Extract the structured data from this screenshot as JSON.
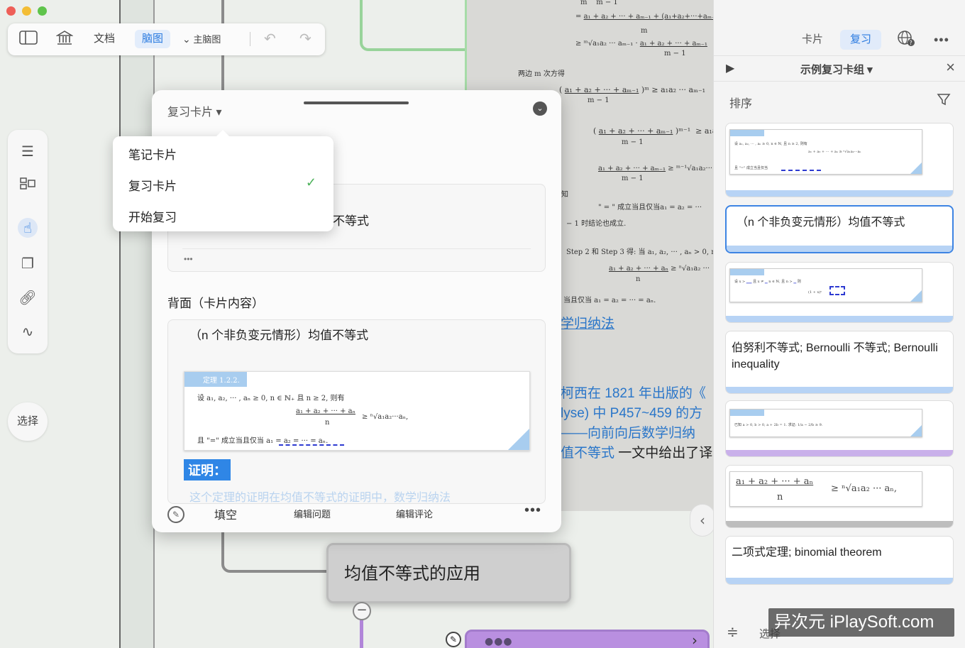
{
  "toolbar": {
    "doc_label": "文档",
    "mindmap_label": "脑图",
    "main_map_label": "主脑图"
  },
  "left_sidebar": {
    "select_label": "选择"
  },
  "document_page": {
    "phrase1": "两边 m 次方得",
    "phrase2": "\" = \" 成立当且仅当a₁ = a₂ = ···",
    "phrase3": "− 1 时结论也成立.",
    "phrase4": "Step 2 和 Step 3 得: 当 a₁, a₂, ··· , aₙ > 0, n",
    "phrase5": "当且仅当 a₁ = a₂ = ··· = aₙ.",
    "phrase6": "知",
    "link1": "学归纳法",
    "text1": "柯西在 1821 年出版的《",
    "text2": "lyse) 中 P457~459 的方",
    "text3": "——向前向后数学归纳",
    "text4_link": "值不等式",
    "text4_rest": " 一文中给出了译"
  },
  "mindmap_node": {
    "label": "均值不等式的应用"
  },
  "popup": {
    "card_type": "复习卡片 ▾",
    "front_text": "不等式",
    "front_more": "•••",
    "back_label": "背面（卡片内容）",
    "back_title": "（n 个非负变元情形）均值不等式",
    "theorem_tag": "定理 1.2.2.",
    "theorem_line1": "设 a₁, a₂, ··· , aₙ ≥ 0, n ∈ ℕ₊ 且 n ≥ 2, 则有",
    "theorem_line2": "a₁ + a₂ + ··· + aₙ",
    "theorem_line3": "n",
    "theorem_line4": "≥ ⁿ√a₁a₂···aₙ,",
    "theorem_line5": "且 \"=\" 成立当且仅当 a₁ = a₂ = ··· = aₙ.",
    "proof_label": "证明：",
    "faded_text": "这个定理的证明在均值不等式的证明中，数学归纳法",
    "btn_fill": "填空",
    "btn_edit_question": "编辑问题",
    "btn_edit_comment": "编辑评论",
    "btn_more": "•••"
  },
  "dropdown": {
    "items": [
      "笔记卡片",
      "复习卡片",
      "开始复习"
    ],
    "selected_check": "✓"
  },
  "right_panel": {
    "tab_cards": "卡片",
    "tab_review": "复习",
    "deck_title": "示例复习卡组 ▾",
    "sort_label": "排序",
    "cards": [
      {
        "type": "image",
        "bar_color": "#b7d3f5"
      },
      {
        "type": "text",
        "text": "（n 个非负变元情形）均值不等式",
        "bar_color": "#b7d3f5"
      },
      {
        "type": "image",
        "bar_color": "#b7d3f5"
      },
      {
        "type": "text",
        "text": "伯努利不等式; Bernoulli 不等式; Bernoulli inequality",
        "bar_color": "#b7d3f5"
      },
      {
        "type": "image",
        "bar_color": "#c9b0ea"
      },
      {
        "type": "formula",
        "numerator": "a₁ + a₂ + ··· + aₙ",
        "denominator": "n",
        "rhs": "≥ ⁿ√a₁a₂ ··· aₙ,",
        "bar_color": "#bdbdbd"
      },
      {
        "type": "text",
        "text": "二项式定理; binomial theorem",
        "bar_color": "#b7d3f5"
      }
    ],
    "bottom_select": "选择"
  },
  "watermark": "异次元 iPlaySoft.com"
}
